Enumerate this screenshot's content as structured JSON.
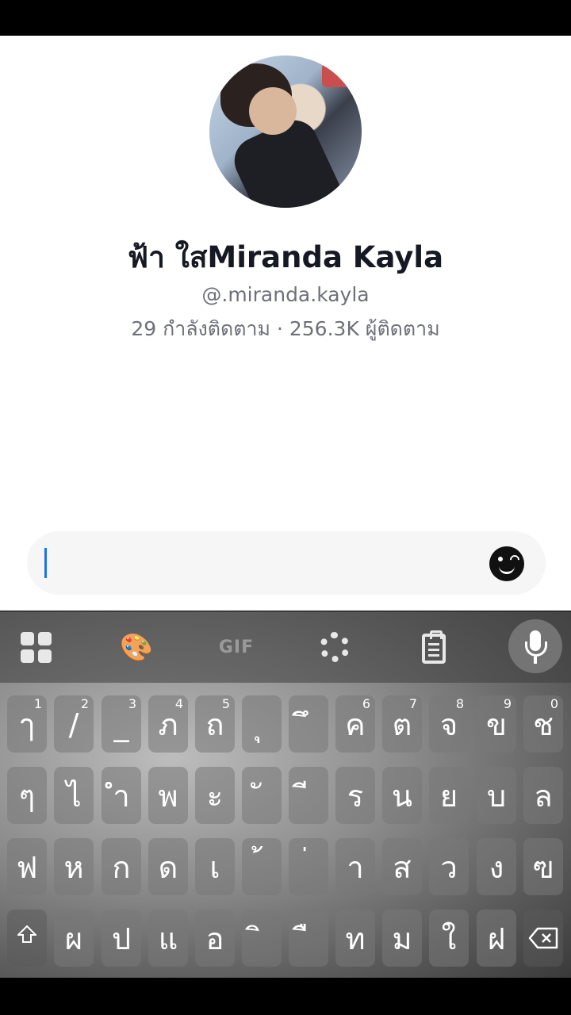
{
  "profile": {
    "display_name": "ฟ้า ใสMiranda Kayla",
    "username": "@.miranda.kayla",
    "following_count": "29",
    "following_label": "กำลังติดตาม",
    "separator": "·",
    "followers_count": "256.3K",
    "followers_label": "ผู้ติดตาม"
  },
  "composer": {
    "value": "",
    "emoji_icon": "smiley-face-icon"
  },
  "keyboard": {
    "toolbar": {
      "apps_icon": "grid-apps-icon",
      "theme_icon": "palette-icon",
      "gif_label": "GIF",
      "settings_icon": "gear-icon",
      "clipboard_icon": "clipboard-icon",
      "voice_icon": "microphone-icon"
    },
    "row1": [
      {
        "char": "ๅ",
        "hint": "1"
      },
      {
        "char": "/",
        "hint": "2"
      },
      {
        "char": "_",
        "hint": "3"
      },
      {
        "char": "ภ",
        "hint": "4"
      },
      {
        "char": "ถ",
        "hint": "5"
      },
      {
        "char": "ุ",
        "hint": ""
      },
      {
        "char": "ึ",
        "hint": ""
      },
      {
        "char": "ค",
        "hint": "6"
      },
      {
        "char": "ต",
        "hint": "7"
      },
      {
        "char": "จ",
        "hint": "8"
      },
      {
        "char": "ข",
        "hint": "9"
      },
      {
        "char": "ช",
        "hint": "0"
      }
    ],
    "row2": [
      "ๆ",
      "ไ",
      "ำ",
      "พ",
      "ะ",
      "ั",
      "ี",
      "ร",
      "น",
      "ย",
      "บ",
      "ล"
    ],
    "row3": [
      "ฟ",
      "ห",
      "ก",
      "ด",
      "เ",
      "้",
      "่",
      "า",
      "ส",
      "ว",
      "ง",
      "ฃ"
    ],
    "row4": [
      "ผ",
      "ป",
      "แ",
      "อ",
      "ิ",
      "ื",
      "ท",
      "ม",
      "ใ",
      "ฝ"
    ],
    "shift_icon": "shift-arrow-icon",
    "backspace_icon": "backspace-icon"
  }
}
